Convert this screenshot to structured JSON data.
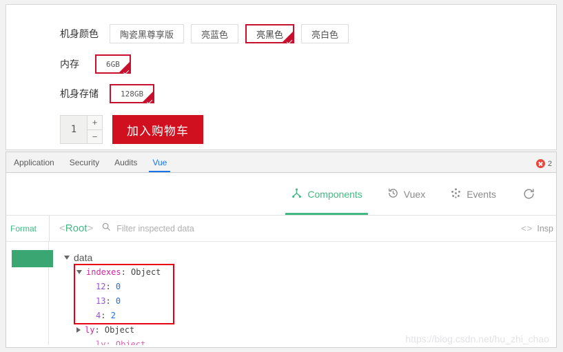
{
  "product": {
    "options": [
      {
        "label": "机身颜色",
        "name": "body-color",
        "choices": [
          {
            "text": "陶瓷黑尊享版",
            "selected": false
          },
          {
            "text": "亮蓝色",
            "selected": false
          },
          {
            "text": "亮黑色",
            "selected": true
          },
          {
            "text": "亮白色",
            "selected": false
          }
        ]
      },
      {
        "label": "内存",
        "name": "memory",
        "choices": [
          {
            "text": "6GB",
            "selected": true,
            "mono": true
          }
        ]
      },
      {
        "label": "机身存储",
        "name": "storage",
        "choices": [
          {
            "text": "128GB",
            "selected": true,
            "mono": true
          }
        ]
      }
    ],
    "quantity": {
      "value": "1",
      "increment": "+",
      "decrement": "−"
    },
    "cart_button": "加入购物车"
  },
  "devtools": {
    "tabs": [
      {
        "label": "Application",
        "active": false
      },
      {
        "label": "Security",
        "active": false
      },
      {
        "label": "Audits",
        "active": false
      },
      {
        "label": "Vue",
        "active": true
      }
    ],
    "error_count": "2",
    "error_icon": "error-circle-x-icon",
    "accent_blue": "#1a73e8"
  },
  "vue_panel": {
    "tabs": [
      {
        "label": "Components",
        "icon": "component-tree-icon",
        "active": true
      },
      {
        "label": "Vuex",
        "icon": "clock-history-icon",
        "active": false
      },
      {
        "label": "Events",
        "icon": "events-dots-icon",
        "active": false
      }
    ],
    "refresh_icon": "refresh-icon",
    "accent_green": "#42b983"
  },
  "inspector": {
    "format_label": "Format",
    "root_open": "<",
    "root_name": "Root",
    "root_close": ">",
    "search_icon": "search-icon",
    "filter_placeholder": "Filter inspected data",
    "inspect_dom_icon": "code-brackets-icon",
    "inspect_dom_label": "Insp"
  },
  "tree": {
    "section_label": "data",
    "highlight_color": "#e60012",
    "nodes": [
      {
        "key": "indexes",
        "punct": ":",
        "type": "Object",
        "expanded": true,
        "entries": [
          {
            "key": "12",
            "punct": ":",
            "value": "0"
          },
          {
            "key": "13",
            "punct": ":",
            "value": "0"
          },
          {
            "key": "4",
            "punct": ":",
            "value": "2"
          }
        ]
      },
      {
        "key": "ly",
        "punct": ":",
        "type": "Object",
        "expanded": false
      }
    ],
    "clipped_node": "ly: Object"
  },
  "watermark": "https://blog.csdn.net/hu_zhi_chao"
}
